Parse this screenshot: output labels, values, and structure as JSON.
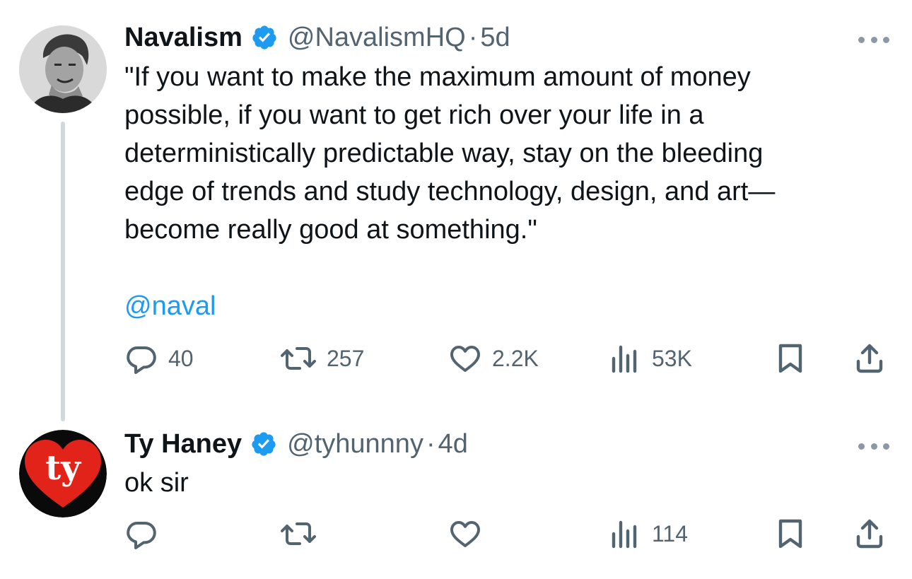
{
  "tweets": [
    {
      "display_name": "Navalism",
      "handle": "@NavalismHQ",
      "separator": "·",
      "time": "5d",
      "text_lines": [
        "\"If you want to make the maximum amount of money",
        "possible, if you want to get rich over your life in a",
        "deterministically predictable way, stay on the bleeding",
        "edge of trends and study technology, design, and art—",
        "become really good at something.\""
      ],
      "mention": "@naval",
      "replies": "40",
      "retweets": "257",
      "likes": "2.2K",
      "views": "53K"
    },
    {
      "display_name": "Ty Haney",
      "handle": "@tyhunnny",
      "separator": "·",
      "time": "4d",
      "text": "ok sir",
      "replies": "",
      "retweets": "",
      "likes": "",
      "views": "114"
    }
  ],
  "avatar2_logo_text": "ty",
  "colors": {
    "text": "#0f1419",
    "secondary": "#536471",
    "link": "#1d9bf0",
    "verified": "#1d9bf0",
    "thread_line": "#cfd9de",
    "ty_red": "#e2231a"
  }
}
